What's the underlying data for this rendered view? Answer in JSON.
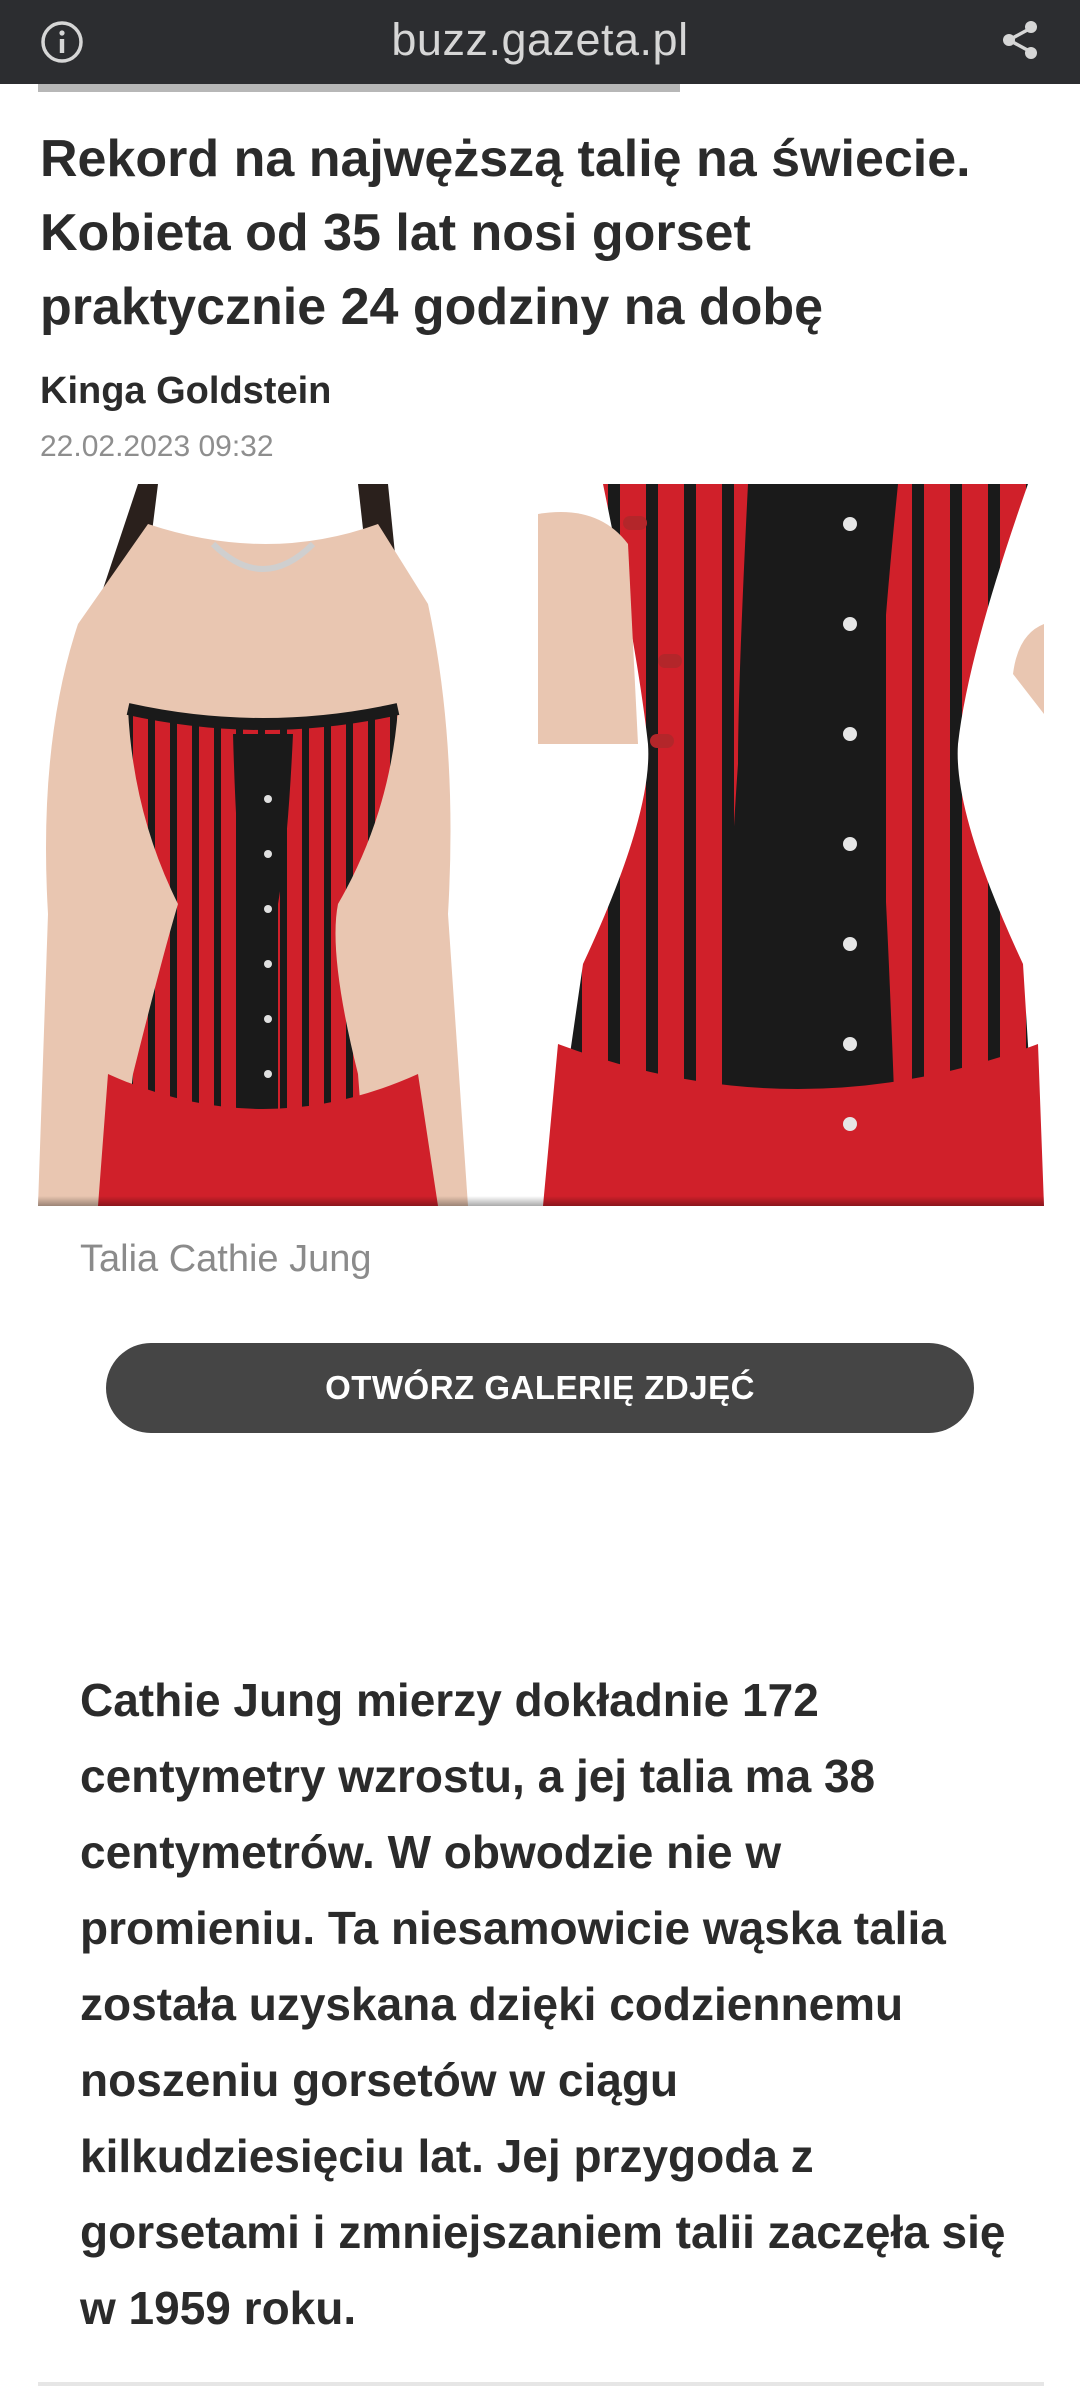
{
  "browser": {
    "url": "buzz.gazeta.pl",
    "icons": {
      "left": "info-icon",
      "right": "share-icon"
    },
    "bar_color": "#2c2d30",
    "loading_progress": 0.63
  },
  "article": {
    "title": "Rekord na najwęższą talię na świecie. Kobieta od 35 lat nosi gorset praktycznie 24 godziny na dobę",
    "author": "Kinga Goldstein",
    "date": "22.02.2023 09:32",
    "image_caption": "Talia Cathie Jung",
    "gallery_button": "OTWÓRZ GALERIĘ ZDJĘĆ",
    "lead": "Cathie Jung mierzy dokładnie 172 centymetry wzrostu, a jej talia ma 38 centymetrów. W obwodzie nie w promieniu. Ta niesamowicie wąska talia została uzyskana dzięki codziennemu noszeniu gorsetów w ciągu kilkudziesięciu lat. Jej przygoda z gorsetami i zmniejszaniem talii zaczęła się w 1959 roku."
  },
  "colors": {
    "button_bg": "#454545",
    "corset_red": "#d0202a",
    "corset_black": "#1a1a1a"
  }
}
